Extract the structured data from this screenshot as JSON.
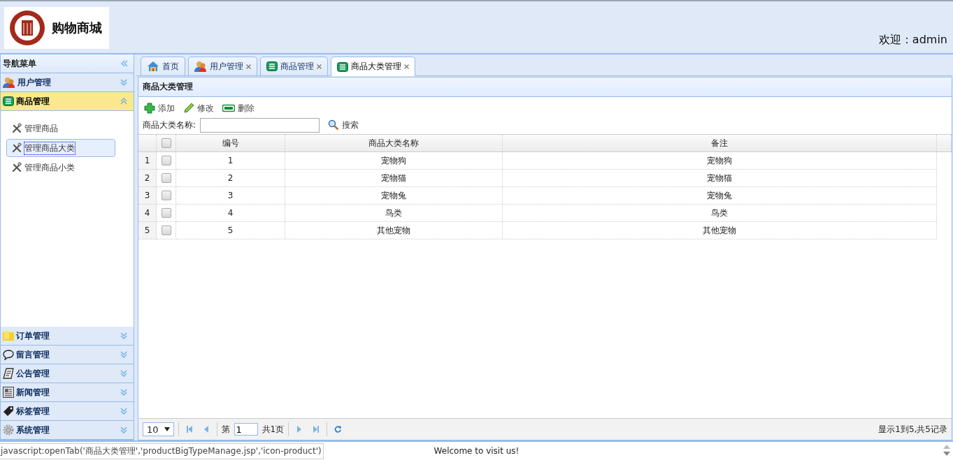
{
  "header": {
    "logo_text": "购物商城",
    "welcome_label": "欢迎：",
    "user": "admin"
  },
  "nav": {
    "title": "导航菜单",
    "sections": [
      {
        "label": "用户管理",
        "expanded": false
      },
      {
        "label": "商品管理",
        "expanded": true,
        "items": [
          {
            "label": "管理商品",
            "selected": false
          },
          {
            "label": "管理商品大类",
            "selected": true
          },
          {
            "label": "管理商品小类",
            "selected": false
          }
        ]
      },
      {
        "label": "订单管理",
        "expanded": false
      },
      {
        "label": "留言管理",
        "expanded": false
      },
      {
        "label": "公告管理",
        "expanded": false
      },
      {
        "label": "新闻管理",
        "expanded": false
      },
      {
        "label": "标签管理",
        "expanded": false
      },
      {
        "label": "系统管理",
        "expanded": false
      }
    ]
  },
  "tabs": [
    {
      "label": "首页",
      "selected": false,
      "closable": false
    },
    {
      "label": "用户管理",
      "selected": false,
      "closable": true
    },
    {
      "label": "商品管理",
      "selected": false,
      "closable": true
    },
    {
      "label": "商品大类管理",
      "selected": true,
      "closable": true
    }
  ],
  "panel": {
    "title": "商品大类管理",
    "toolbar": [
      "添加",
      "修改",
      "删除"
    ],
    "search": {
      "label": "商品大类名称:",
      "button": "搜索"
    },
    "table": {
      "all_checked": false,
      "columns": [
        "编号",
        "商品大类名称",
        "备注"
      ],
      "rows": [
        {
          "number": "1",
          "checked": false,
          "cells": [
            "1",
            "宠物狗",
            "宠物狗"
          ]
        },
        {
          "number": "2",
          "checked": false,
          "cells": [
            "2",
            "宠物猫",
            "宠物猫"
          ]
        },
        {
          "number": "3",
          "checked": false,
          "cells": [
            "3",
            "宠物兔",
            "宠物兔"
          ]
        },
        {
          "number": "4",
          "checked": false,
          "cells": [
            "4",
            "鸟类",
            "鸟类"
          ]
        },
        {
          "number": "5",
          "checked": false,
          "cells": [
            "5",
            "其他宠物",
            "其他宠物"
          ]
        }
      ]
    },
    "pager": {
      "page_size": "10",
      "page_prefix": "第",
      "page": "1",
      "page_total": "共1页",
      "info": "显示1到5,共5记录"
    }
  },
  "footer": {
    "text": "Welcome to visit us!"
  },
  "browser_status": "javascript:openTab('商品大类管理','productBigTypeManage.jsp','icon-product')"
}
